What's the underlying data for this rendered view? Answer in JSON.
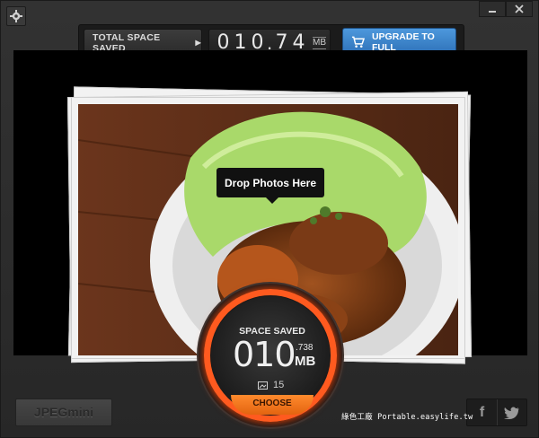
{
  "window": {
    "settings_icon": "gear-icon",
    "minimize_icon": "minimize-icon",
    "close_icon": "close-icon"
  },
  "header": {
    "total_space_saved_label": "TOTAL SPACE SAVED",
    "total_space_saved_arrow": "▶",
    "counter_digits": [
      "0",
      "1",
      "0"
    ],
    "counter_decimal_sep": ".",
    "counter_decimals": [
      "7",
      "4"
    ],
    "counter_unit": "MB",
    "upgrade_label": "UPGRADE TO FULL",
    "upgrade_icon": "cart-icon"
  },
  "drop_area": {
    "tooltip": "Drop Photos Here",
    "photo_subject": "food-photo"
  },
  "gauge": {
    "label": "SPACE SAVED",
    "value": "010",
    "value_decimal": ".738",
    "value_unit": "MB",
    "photo_count_icon": "image-icon",
    "photo_count": "15",
    "choose_label": "CHOOSE"
  },
  "footer": {
    "brand": "JPEGmini",
    "facebook_label": "f",
    "twitter_icon": "twitter-icon",
    "watermark": "綠色工廠 Portable.easylife.tw"
  },
  "colors": {
    "accent_blue": "#3a84cc",
    "gauge_orange": "#ff5a1f",
    "choose_orange": "#f07a22",
    "background": "#2b2b2b"
  }
}
